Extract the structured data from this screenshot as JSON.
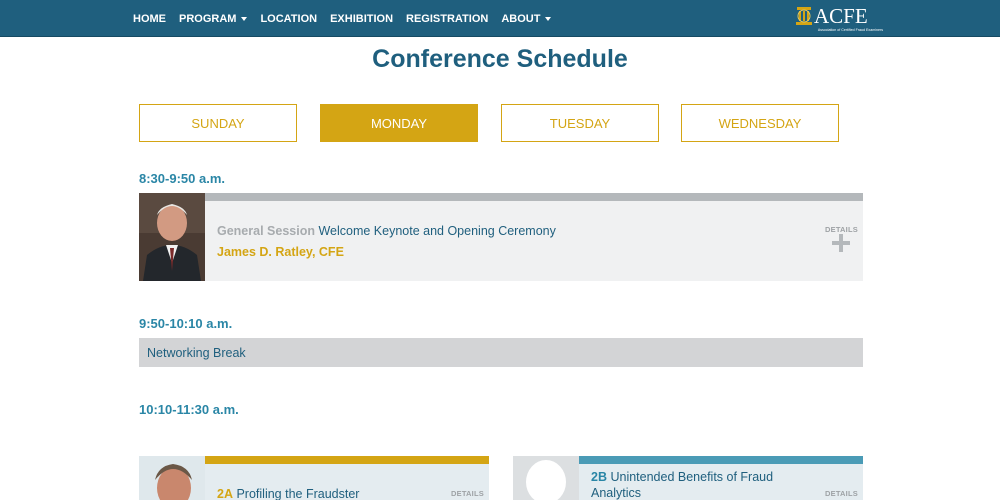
{
  "nav": {
    "items": [
      {
        "label": "HOME",
        "dropdown": false
      },
      {
        "label": "PROGRAM",
        "dropdown": true
      },
      {
        "label": "LOCATION",
        "dropdown": false
      },
      {
        "label": "EXHIBITION",
        "dropdown": false
      },
      {
        "label": "REGISTRATION",
        "dropdown": false
      },
      {
        "label": "ABOUT",
        "dropdown": true
      }
    ],
    "logo_text": "ACFE",
    "logo_subtitle": "Association of Certified Fraud Examiners"
  },
  "page_title": "Conference Schedule",
  "days": [
    {
      "label": "SUNDAY",
      "active": false
    },
    {
      "label": "MONDAY",
      "active": true
    },
    {
      "label": "TUESDAY",
      "active": false
    },
    {
      "label": "WEDNESDAY",
      "active": false
    }
  ],
  "schedule": {
    "slot1": {
      "time": "8:30-9:50 a.m.",
      "session_type": "General Session",
      "title": "Welcome Keynote and Opening Ceremony",
      "speaker": "James D. Ratley, CFE",
      "details_label": "DETAILS"
    },
    "slot2": {
      "time": "9:50-10:10 a.m.",
      "break_label": "Networking Break"
    },
    "slot3": {
      "time": "10:10-11:30 a.m.",
      "sessions": [
        {
          "code": "2A",
          "title": "Profiling the Fraudster",
          "details_label": "DETAILS"
        },
        {
          "code": "2B",
          "title": "Unintended Benefits of Fraud Analytics",
          "details_label": "DETAILS"
        }
      ]
    }
  },
  "colors": {
    "nav_bg": "#1f5f7e",
    "accent_gold": "#d4a514",
    "heading_blue": "#1f5f7e",
    "time_blue": "#2a86a6",
    "card_bar_blue": "#4a9bb6"
  }
}
